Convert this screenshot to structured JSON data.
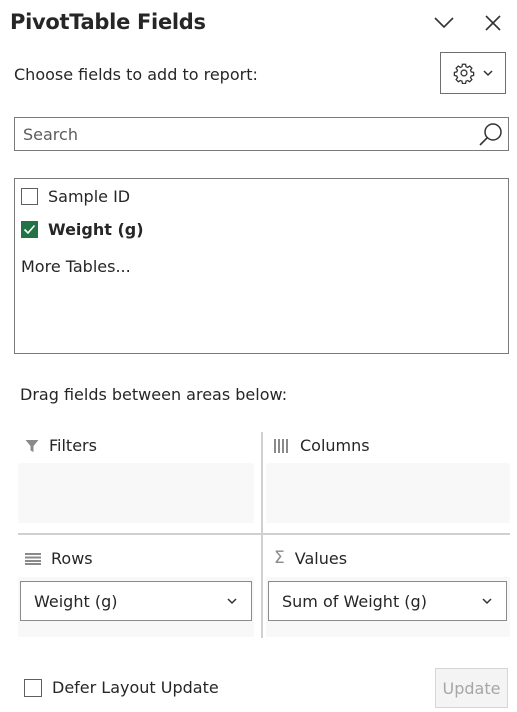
{
  "panel": {
    "title": "PivotTable Fields",
    "choose_label": "Choose fields to add to report:"
  },
  "search": {
    "placeholder": "Search",
    "value": ""
  },
  "fields": [
    {
      "label": "Sample ID",
      "checked": false
    },
    {
      "label": "Weight (g)",
      "checked": true
    }
  ],
  "more_tables": "More Tables...",
  "drag_label": "Drag fields between areas below:",
  "areas": {
    "filters": {
      "title": "Filters",
      "icon": "filter-icon"
    },
    "columns": {
      "title": "Columns",
      "icon": "columns-icon"
    },
    "rows": {
      "title": "Rows",
      "icon": "rows-icon",
      "item": "Weight (g)"
    },
    "values": {
      "title": "Values",
      "icon": "sigma-icon",
      "item": "Sum of Weight (g)"
    }
  },
  "defer": {
    "label": "Defer Layout Update",
    "checked": false
  },
  "update_button": "Update",
  "colors": {
    "checked_accent": "#217346",
    "text": "#262626",
    "disabled_text": "#a6a6a6"
  }
}
